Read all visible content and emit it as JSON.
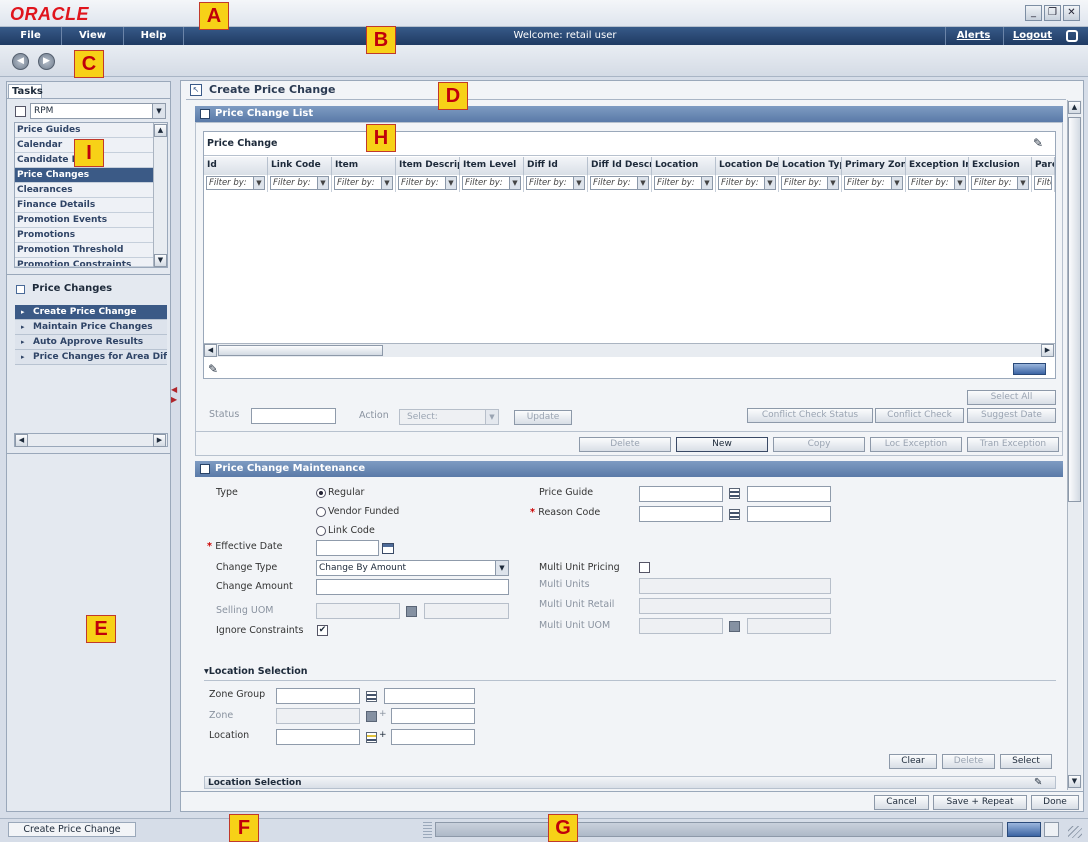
{
  "window": {
    "brand": "ORACLE",
    "min": "_",
    "restore": "❐",
    "close": "✕"
  },
  "menu": {
    "items": [
      "File",
      "View",
      "Help"
    ],
    "welcome": "Welcome: retail user",
    "alerts": "Alerts",
    "logout": "Logout",
    "lock_icon": "lock-icon"
  },
  "nav": {
    "back": "◀",
    "forward": "▶"
  },
  "letters": {
    "a": "A",
    "b": "B",
    "c": "C",
    "d": "D",
    "e": "E",
    "f": "F",
    "g": "G",
    "h": "H",
    "i": "I"
  },
  "tasks": {
    "tab": "Tasks",
    "module": "RPM",
    "items": [
      "Price Guides",
      "Calendar",
      "Candidate R",
      "Price Changes",
      "Clearances",
      "Finance Details",
      "Promotion Events",
      "Promotions",
      "Promotion Threshold",
      "Promotion Constraints"
    ],
    "selected_index": 3,
    "sub_title": "Price Changes",
    "sub_items": [
      "Create Price Change",
      "Maintain Price Changes",
      "Auto Approve Results",
      "Price Changes for Area Diff"
    ],
    "sub_selected_index": 0
  },
  "page": {
    "title": "Create Price Change"
  },
  "list": {
    "section_title": "Price Change List",
    "table_title": "Price Change",
    "columns": [
      "Id",
      "Link Code",
      "Item",
      "Item Descript",
      "Item Level",
      "Diff Id",
      "Diff Id Descri",
      "Location",
      "Location Desc",
      "Location Type",
      "Primary Zone",
      "Exception Ind",
      "Exclusion",
      "Pare"
    ],
    "filter_placeholder": "Filter by:",
    "select_all": "Select All",
    "status_label": "Status",
    "action_label": "Action",
    "action_value": "Select:",
    "update": "Update",
    "conflict_check_status": "Conflict Check Status",
    "conflict_check": "Conflict Check",
    "suggest_date": "Suggest Date",
    "delete": "Delete",
    "new": "New",
    "copy": "Copy",
    "loc_exception": "Loc Exception",
    "tran_exception": "Tran Exception"
  },
  "maint": {
    "section_title": "Price Change Maintenance",
    "type_label": "Type",
    "type_options": [
      "Regular",
      "Vendor Funded",
      "Link Code"
    ],
    "type_selected": 0,
    "effective_date": "Effective Date",
    "change_type": "Change Type",
    "change_type_value": "Change By Amount",
    "change_amount": "Change Amount",
    "selling_uom": "Selling UOM",
    "ignore_constraints": "Ignore Constraints",
    "ignore_constraints_checked": "✔",
    "price_guide": "Price Guide",
    "reason_code": "Reason Code",
    "multi_unit_pricing": "Multi Unit Pricing",
    "multi_units": "Multi Units",
    "multi_unit_retail": "Multi Unit Retail",
    "multi_unit_uom": "Multi Unit UOM",
    "location_selection": "Location Selection",
    "zone_group": "Zone Group",
    "zone": "Zone",
    "location": "Location",
    "clear": "Clear",
    "delete": "Delete",
    "select": "Select",
    "location_selection_table": "Location Selection"
  },
  "footer": {
    "cancel": "Cancel",
    "save_repeat": "Save + Repeat",
    "done": "Done"
  },
  "statusbar": {
    "task": "Create Price Change"
  }
}
